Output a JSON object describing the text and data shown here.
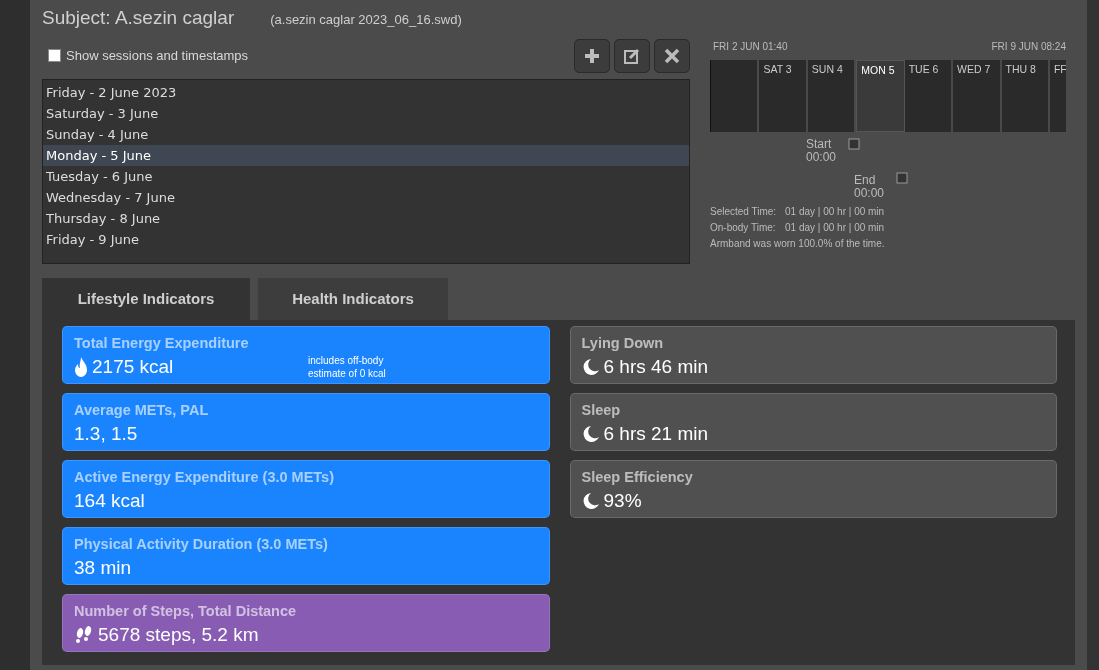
{
  "subject": {
    "title": "Subject: A.sezin caglar",
    "file": "(a.sezin caglar 2023_06_16.swd)"
  },
  "show_sessions": {
    "label": "Show sessions and timestamps",
    "checked": false
  },
  "toolbar": [
    {
      "kind": "add"
    },
    {
      "kind": "edit"
    },
    {
      "kind": "delete"
    }
  ],
  "days": [
    {
      "label": "Friday - 2 June 2023",
      "selected": false
    },
    {
      "label": "Saturday - 3 June",
      "selected": false
    },
    {
      "label": "Sunday - 4 June",
      "selected": false
    },
    {
      "label": "Monday - 5 June",
      "selected": true
    },
    {
      "label": "Tuesday - 6 June",
      "selected": false
    },
    {
      "label": "Wednesday - 7 June",
      "selected": false
    },
    {
      "label": "Thursday - 8 June",
      "selected": false
    },
    {
      "label": "Friday - 9 June",
      "selected": false
    }
  ],
  "timeline": {
    "range_start": "FRI 2 JUN 01:40",
    "range_end": "FRI 9 JUN 08:24",
    "days": [
      {
        "selected": false
      },
      {
        "label": "SAT 3",
        "selected": false
      },
      {
        "label": "SUN 4",
        "selected": false
      },
      {
        "label": "MON 5",
        "selected": true
      },
      {
        "label": "TUE 6",
        "selected": false
      },
      {
        "label": "WED 7",
        "selected": false
      },
      {
        "label": "THU 8",
        "selected": false
      },
      {
        "label": "FF",
        "selected": false
      }
    ],
    "start_label": "Start",
    "start_time": "00:00",
    "end_label": "End",
    "end_time": "00:00",
    "stats": [
      {
        "label": "Selected Time:",
        "value": "01 day | 00 hr | 00 min"
      },
      {
        "label": "On-body Time:",
        "value": "01 day | 00 hr | 00 min"
      }
    ],
    "worn_note": "Armband was worn 100.0% of the time."
  },
  "tabs": [
    {
      "label": "Lifestyle Indicators",
      "selected": true
    },
    {
      "label": "Health Indicators",
      "selected": false
    }
  ],
  "lifestyle": [
    {
      "title": "Total Energy Expenditure",
      "value": "2175 kcal",
      "kind": "fire",
      "color": "#1a84ff",
      "note": "includes off-body estimate of 0 kcal"
    },
    {
      "title": "Average METs, PAL",
      "value": "1.3, 1.5",
      "kind": "plain",
      "color": "#1a84ff"
    },
    {
      "title": "Active Energy Expenditure (3.0 METs)",
      "value": "164 kcal",
      "kind": "plain",
      "color": "#1a84ff"
    },
    {
      "title": "Physical Activity Duration (3.0 METs)",
      "value": "38 min",
      "kind": "plain",
      "color": "#1a84ff"
    },
    {
      "title": "Number of Steps, Total Distance",
      "value": "5678 steps, 5.2 km",
      "kind": "steps",
      "color": "#875cb2"
    }
  ],
  "sleep": [
    {
      "title": "Lying Down",
      "value": "6 hrs 46 min",
      "kind": "moon",
      "color": "#505050"
    },
    {
      "title": "Sleep",
      "value": "6 hrs 21 min",
      "kind": "moon",
      "color": "#505050"
    },
    {
      "title": "Sleep Efficiency",
      "value": "93%",
      "kind": "moon",
      "color": "#505050"
    }
  ]
}
